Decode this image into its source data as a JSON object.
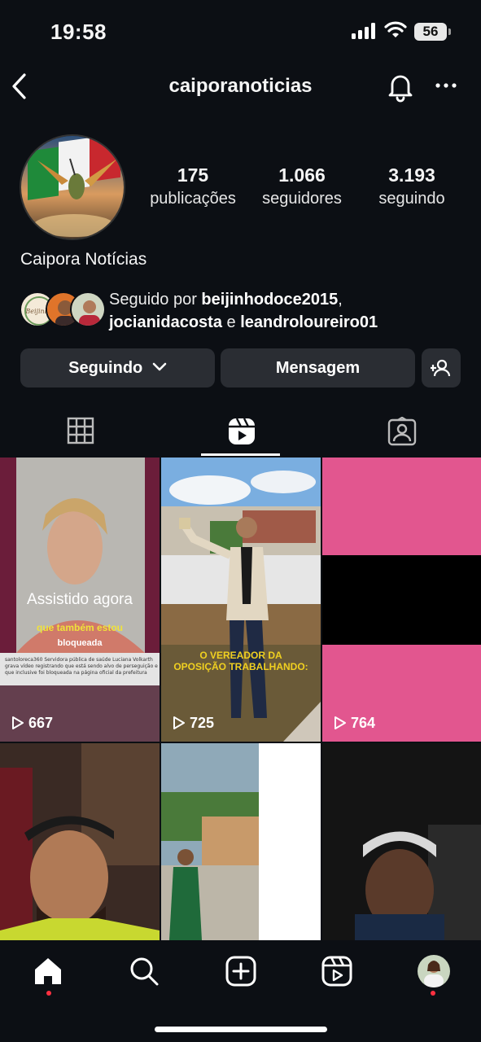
{
  "status": {
    "time": "19:58",
    "battery": "56"
  },
  "header": {
    "username": "caiporanoticias"
  },
  "profile": {
    "display_name": "Caipora Notícias",
    "stats": [
      {
        "value": "175",
        "label": "publicações"
      },
      {
        "value": "1.066",
        "label": "seguidores"
      },
      {
        "value": "3.193",
        "label": "seguindo"
      }
    ],
    "followed_by": {
      "prefix": "Seguido por ",
      "user1": "beijinhodoce2015",
      "sep": ",",
      "user2": "jocianidacosta",
      "and": " e ",
      "user3": "leandroloureiro01"
    }
  },
  "actions": {
    "following": "Seguindo",
    "message": "Mensagem"
  },
  "grid": [
    {
      "overlay": "Assistido agora",
      "caption": "que também estou",
      "caption2": "bloqueada",
      "count": "667"
    },
    {
      "caption": "O VEREADOR DA",
      "caption2": "OPOSIÇÃO TRABALHANDO:",
      "count": "725"
    },
    {
      "count": "764"
    }
  ],
  "colors": {
    "bg": "#0c0f14",
    "button": "#2a2d33",
    "pink": "#e2568f",
    "notification": "#ff3040"
  }
}
